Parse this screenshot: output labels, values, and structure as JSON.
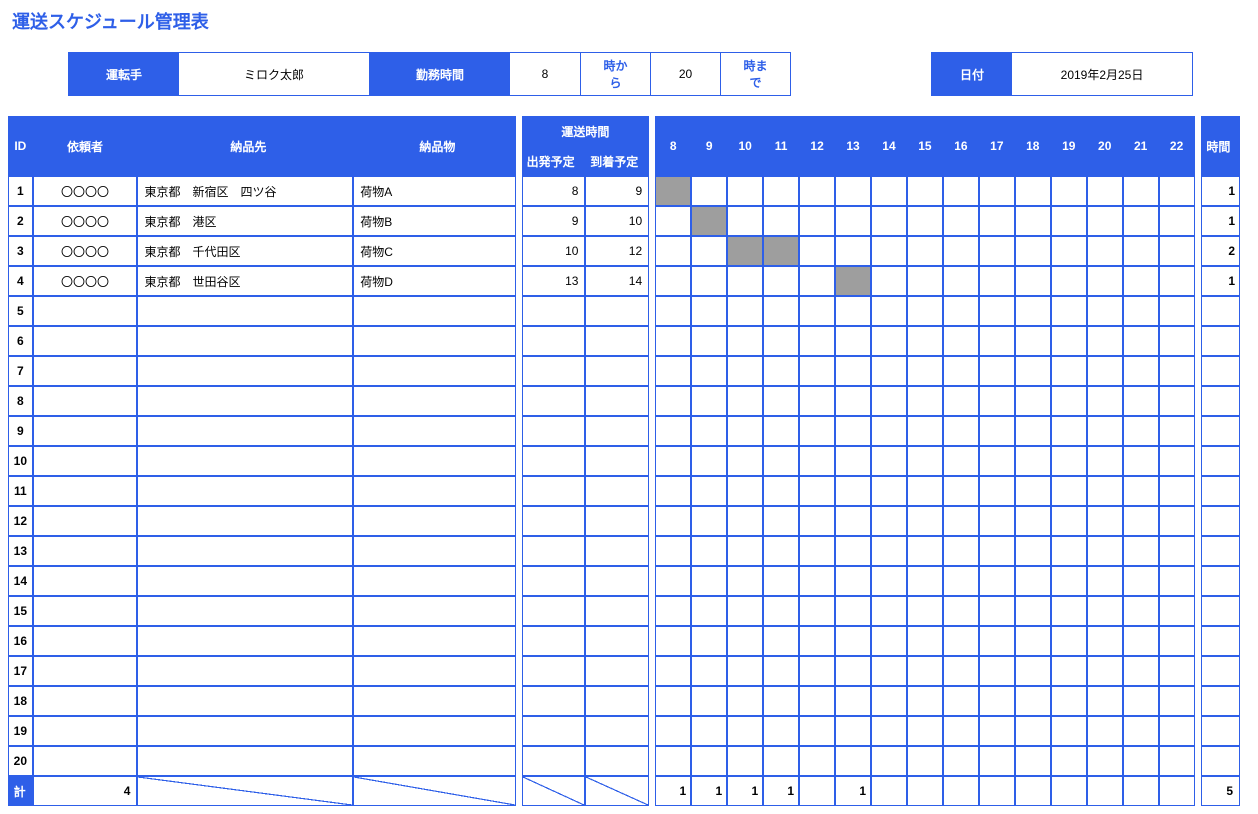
{
  "title": "運送スケジュール管理表",
  "info": {
    "driver_label": "運転手",
    "driver_value": "ミロク太郎",
    "hours_label": "勤務時間",
    "from_value": "8",
    "from_label": "時から",
    "to_value": "20",
    "to_label": "時まで",
    "date_label": "日付",
    "date_value": "2019年2月25日"
  },
  "headers": {
    "id": "ID",
    "client": "依頼者",
    "dest": "納品先",
    "item": "納品物",
    "transport": "運送時間",
    "dep": "出発予定",
    "arr": "到着予定",
    "hours": [
      "8",
      "9",
      "10",
      "11",
      "12",
      "13",
      "14",
      "15",
      "16",
      "17",
      "18",
      "19",
      "20",
      "21",
      "22"
    ],
    "duration": "時間"
  },
  "rows": [
    {
      "id": "1",
      "client": "〇〇〇〇",
      "dest": "東京都　新宿区　四ツ谷",
      "item": "荷物A",
      "dep": "8",
      "arr": "9",
      "start": 8,
      "end": 9,
      "dur": "1"
    },
    {
      "id": "2",
      "client": "〇〇〇〇",
      "dest": "東京都　港区",
      "item": "荷物B",
      "dep": "9",
      "arr": "10",
      "start": 9,
      "end": 10,
      "dur": "1"
    },
    {
      "id": "3",
      "client": "〇〇〇〇",
      "dest": "東京都　千代田区",
      "item": "荷物C",
      "dep": "10",
      "arr": "12",
      "start": 10,
      "end": 12,
      "dur": "2"
    },
    {
      "id": "4",
      "client": "〇〇〇〇",
      "dest": "東京都　世田谷区",
      "item": "荷物D",
      "dep": "13",
      "arr": "14",
      "start": 13,
      "end": 14,
      "dur": "1"
    },
    {
      "id": "5"
    },
    {
      "id": "6"
    },
    {
      "id": "7"
    },
    {
      "id": "8"
    },
    {
      "id": "9"
    },
    {
      "id": "10"
    },
    {
      "id": "11"
    },
    {
      "id": "12"
    },
    {
      "id": "13"
    },
    {
      "id": "14"
    },
    {
      "id": "15"
    },
    {
      "id": "16"
    },
    {
      "id": "17"
    },
    {
      "id": "18"
    },
    {
      "id": "19"
    },
    {
      "id": "20"
    }
  ],
  "summary": {
    "label": "計",
    "count": "4",
    "hours": [
      "1",
      "1",
      "1",
      "1",
      "",
      "1",
      "",
      "",
      "",
      "",
      "",
      "",
      "",
      "",
      ""
    ],
    "total": "5"
  }
}
